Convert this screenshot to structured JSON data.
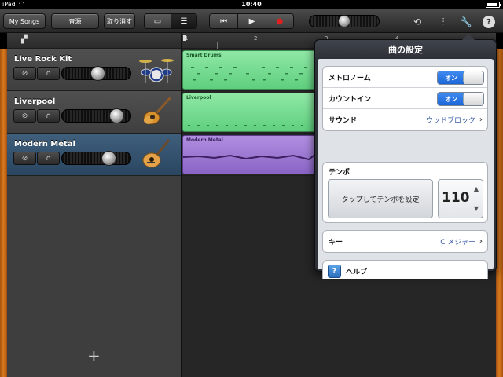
{
  "status_bar": {
    "carrier": "iPad",
    "time": "10:40"
  },
  "toolbar": {
    "my_songs": "My Songs",
    "instrument": "音源",
    "undo": "取り消す",
    "view_toggle": [
      "instrument-view-icon",
      "tracks-view-icon"
    ],
    "transport": [
      "rewind-icon",
      "play-icon",
      "record-icon"
    ],
    "right_icons": [
      "loop-icon",
      "mixer-icon",
      "wrench-icon",
      "help-icon"
    ],
    "help_glyph": "?"
  },
  "tracks": [
    {
      "name": "Live Rock Kit",
      "volume": 0.62,
      "instrument": "drum-kit-icon",
      "selected": false
    },
    {
      "name": "Liverpool",
      "volume": 0.88,
      "instrument": "bass-guitar-icon",
      "selected": false
    },
    {
      "name": "Modern Metal",
      "volume": 0.72,
      "instrument": "electric-guitar-icon",
      "selected": true
    }
  ],
  "add_track_glyph": "+",
  "ruler": {
    "marks": [
      "1",
      "2",
      "3",
      "4"
    ]
  },
  "regions": [
    {
      "name": "Smart Drums",
      "color": "#6fd98c"
    },
    {
      "name": "Liverpool",
      "color": "#6fd98c"
    },
    {
      "name": "Modern Metal",
      "color": "#9a74d4"
    }
  ],
  "song_settings": {
    "title": "曲の設定",
    "metronome": {
      "label": "メトロノーム",
      "state": "オン"
    },
    "count_in": {
      "label": "カウントイン",
      "state": "オン"
    },
    "sound": {
      "label": "サウンド",
      "value": "ウッドブロック"
    },
    "tempo": {
      "label": "テンポ",
      "tap_label": "タップしてテンポを設定",
      "bpm": "110",
      "up": "▲",
      "down": "▼"
    },
    "key": {
      "label": "キー",
      "value": "C メジャー"
    },
    "help": {
      "label": "ヘルプ",
      "glyph": "?"
    },
    "chevron": "›"
  },
  "colors": {
    "accent_blue": "#1c66d8",
    "selected_track": "#2f4d6a",
    "toggle_on": "#3f8af0"
  }
}
